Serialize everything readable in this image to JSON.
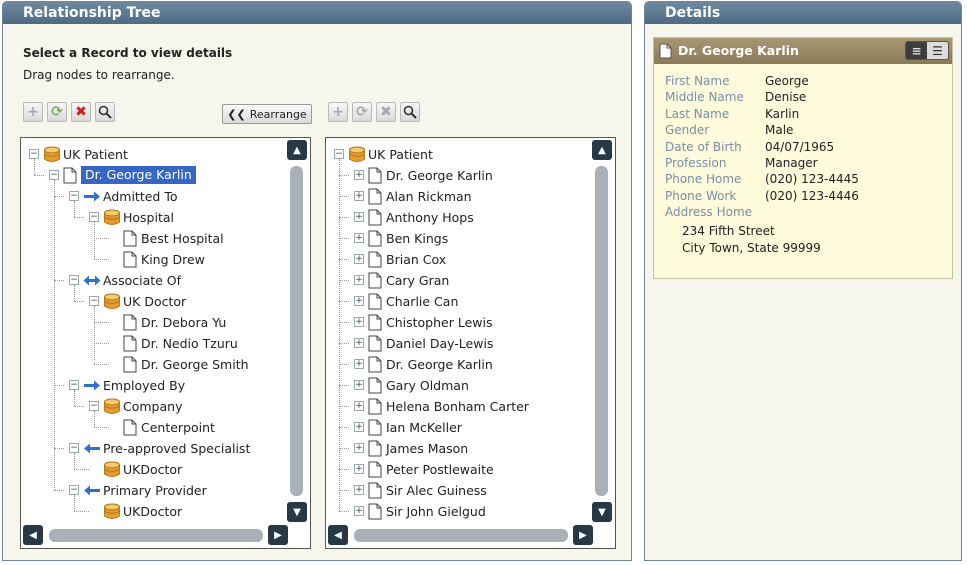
{
  "tree_panel": {
    "title": "Relationship Tree",
    "intro_title": "Select a Record to view details",
    "intro_sub": "Drag nodes to rearrange.",
    "rearrange_label": "Rearrange",
    "rearrange_icon": "double-chevron-left-icon"
  },
  "left_tree": [
    {
      "label": "UK Patient",
      "icon": "database-icon",
      "depth": 0,
      "toggle": "-"
    },
    {
      "label": "Dr. George Karlin",
      "icon": "document-icon",
      "depth": 1,
      "toggle": "-",
      "selected": true
    },
    {
      "label": "Admitted To",
      "icon": "arrow-right-icon",
      "depth": 2,
      "toggle": "-"
    },
    {
      "label": "Hospital",
      "icon": "database-icon",
      "depth": 3,
      "toggle": "-"
    },
    {
      "label": "Best Hospital",
      "icon": "document-icon",
      "depth": 4,
      "toggle": ""
    },
    {
      "label": "King Drew",
      "icon": "document-icon",
      "depth": 4,
      "toggle": ""
    },
    {
      "label": "Associate Of",
      "icon": "arrow-both-icon",
      "depth": 2,
      "toggle": "-"
    },
    {
      "label": "UK Doctor",
      "icon": "database-icon",
      "depth": 3,
      "toggle": "-"
    },
    {
      "label": "Dr. Debora Yu",
      "icon": "document-icon",
      "depth": 4,
      "toggle": ""
    },
    {
      "label": "Dr. Nedio Tzuru",
      "icon": "document-icon",
      "depth": 4,
      "toggle": ""
    },
    {
      "label": "Dr. George Smith",
      "icon": "document-icon",
      "depth": 4,
      "toggle": ""
    },
    {
      "label": "Employed By",
      "icon": "arrow-right-icon",
      "depth": 2,
      "toggle": "-"
    },
    {
      "label": "Company",
      "icon": "database-icon",
      "depth": 3,
      "toggle": "-"
    },
    {
      "label": "Centerpoint",
      "icon": "document-icon",
      "depth": 4,
      "toggle": ""
    },
    {
      "label": "Pre-approved Specialist",
      "icon": "arrow-left-icon",
      "depth": 2,
      "toggle": "-"
    },
    {
      "label": "UKDoctor",
      "icon": "database-icon",
      "depth": 3,
      "toggle": ""
    },
    {
      "label": "Primary Provider",
      "icon": "arrow-left-icon",
      "depth": 2,
      "toggle": "-"
    },
    {
      "label": "UKDoctor",
      "icon": "database-icon",
      "depth": 3,
      "toggle": ""
    }
  ],
  "right_tree": [
    {
      "label": "UK Patient",
      "icon": "database-icon",
      "depth": 0,
      "toggle": "-"
    },
    {
      "label": "Dr. George Karlin",
      "icon": "document-icon",
      "depth": 1,
      "toggle": "+"
    },
    {
      "label": "Alan Rickman",
      "icon": "document-icon",
      "depth": 1,
      "toggle": "+"
    },
    {
      "label": "Anthony Hops",
      "icon": "document-icon",
      "depth": 1,
      "toggle": "+"
    },
    {
      "label": "Ben Kings",
      "icon": "document-icon",
      "depth": 1,
      "toggle": "+"
    },
    {
      "label": "Brian Cox",
      "icon": "document-icon",
      "depth": 1,
      "toggle": "+"
    },
    {
      "label": "Cary Gran",
      "icon": "document-icon",
      "depth": 1,
      "toggle": "+"
    },
    {
      "label": "Charlie  Can",
      "icon": "document-icon",
      "depth": 1,
      "toggle": "+"
    },
    {
      "label": "Chistopher Lewis",
      "icon": "document-icon",
      "depth": 1,
      "toggle": "+"
    },
    {
      "label": "Daniel Day-Lewis",
      "icon": "document-icon",
      "depth": 1,
      "toggle": "+"
    },
    {
      "label": "Dr. George Karlin",
      "icon": "document-icon",
      "depth": 1,
      "toggle": "+"
    },
    {
      "label": "Gary Oldman",
      "icon": "document-icon",
      "depth": 1,
      "toggle": "+"
    },
    {
      "label": "Helena Bonham Carter",
      "icon": "document-icon",
      "depth": 1,
      "toggle": "+"
    },
    {
      "label": "Ian McKeller",
      "icon": "document-icon",
      "depth": 1,
      "toggle": "+"
    },
    {
      "label": "James Mason",
      "icon": "document-icon",
      "depth": 1,
      "toggle": "+"
    },
    {
      "label": "Peter Postlewaite",
      "icon": "document-icon",
      "depth": 1,
      "toggle": "+"
    },
    {
      "label": "Sir Alec Guiness",
      "icon": "document-icon",
      "depth": 1,
      "toggle": "+"
    },
    {
      "label": "Sir John Gielgud",
      "icon": "document-icon",
      "depth": 1,
      "toggle": "+"
    }
  ],
  "details_panel": {
    "title": "Details",
    "card_title": "Dr. George Karlin",
    "fields": [
      {
        "key": "First Name",
        "value": "George"
      },
      {
        "key": "Middle Name",
        "value": "Denise"
      },
      {
        "key": "Last Name",
        "value": "Karlin"
      },
      {
        "key": "Gender",
        "value": "Male"
      },
      {
        "key": "Date of Birth",
        "value": "04/07/1965"
      },
      {
        "key": "Profession",
        "value": "Manager"
      },
      {
        "key": "Phone Home",
        "value": "(020) 123-4445"
      },
      {
        "key": "Phone Work",
        "value": "(020) 123-4446"
      },
      {
        "key": "Address Home",
        "value": ""
      }
    ],
    "address_lines": [
      "234 Fifth Street",
      "City Town, State 99999"
    ]
  },
  "colors": {
    "header": "#5b7890",
    "selection": "#3568c6",
    "card_header": "#9b8a66",
    "card_bg": "#fdfbdc",
    "scrollbar_button": "#283844"
  }
}
